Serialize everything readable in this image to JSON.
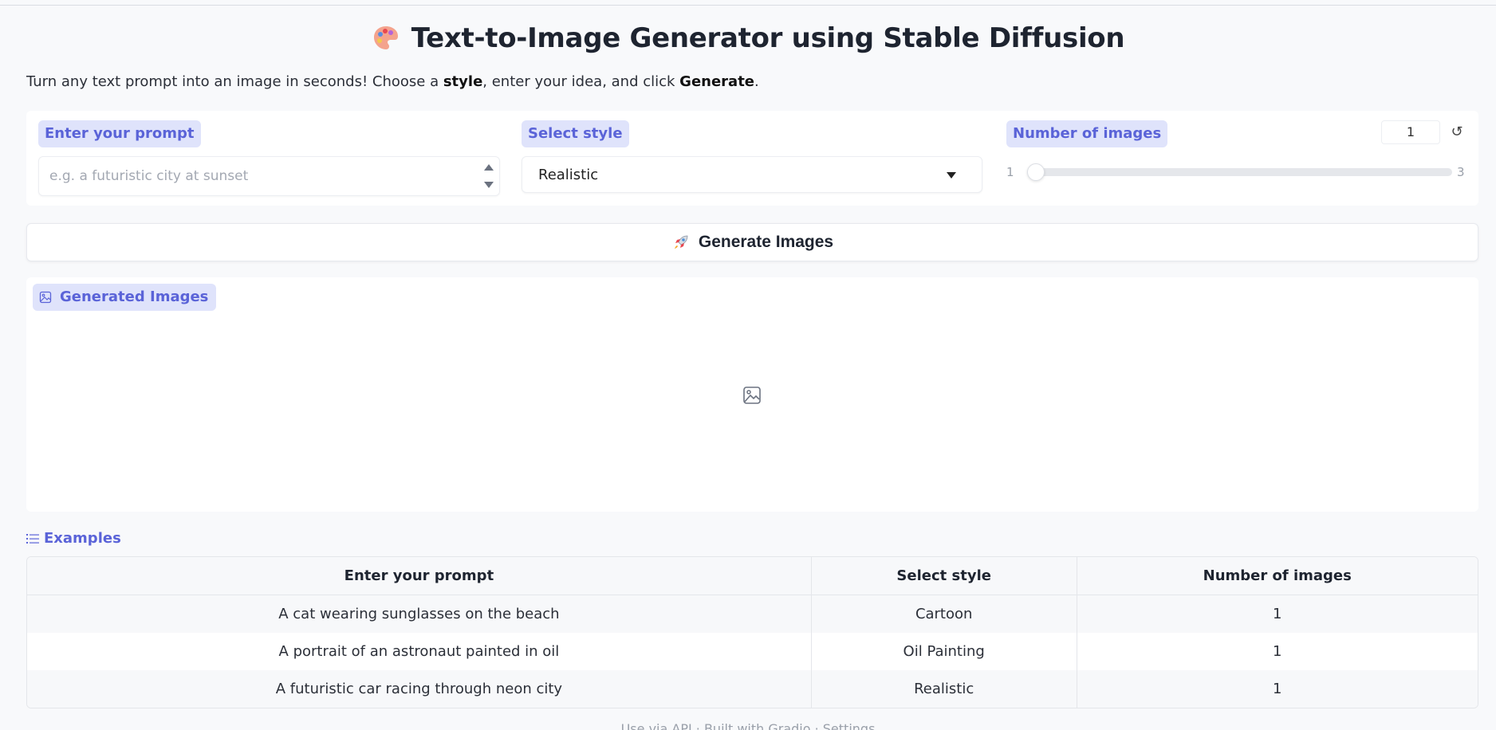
{
  "header": {
    "palette_icon": "artist-palette-icon",
    "title": "Text-to-Image Generator using Stable Diffusion"
  },
  "intro": {
    "part1": "Turn any text prompt into an image in seconds! Choose a ",
    "style_word": "style",
    "part2": ", enter your idea, and click ",
    "generate_word": "Generate",
    "part3": "."
  },
  "prompt": {
    "label": "Enter your prompt",
    "placeholder": "e.g. a futuristic city at sunset"
  },
  "style": {
    "label": "Select style",
    "selected": "Realistic"
  },
  "num_images": {
    "label": "Number of images",
    "value": "1",
    "min": "1",
    "max": "3",
    "slider_fraction": 0.0
  },
  "generate_button": {
    "icon": "rocket-icon",
    "label": "Generate Images"
  },
  "gallery": {
    "label": "Generated Images",
    "icon": "image-icon"
  },
  "examples": {
    "title": "Examples",
    "columns": [
      "Enter your prompt",
      "Select style",
      "Number of images"
    ],
    "rows": [
      [
        "A cat wearing sunglasses on the beach",
        "Cartoon",
        "1"
      ],
      [
        "A portrait of an astronaut painted in oil",
        "Oil Painting",
        "1"
      ],
      [
        "A futuristic car racing through neon city",
        "Realistic",
        "1"
      ]
    ]
  },
  "footer": {
    "text": "Use via API · Built with Gradio · Settings"
  },
  "colors": {
    "accent": "#5a63d8",
    "pill_bg": "#dfe3fb"
  }
}
